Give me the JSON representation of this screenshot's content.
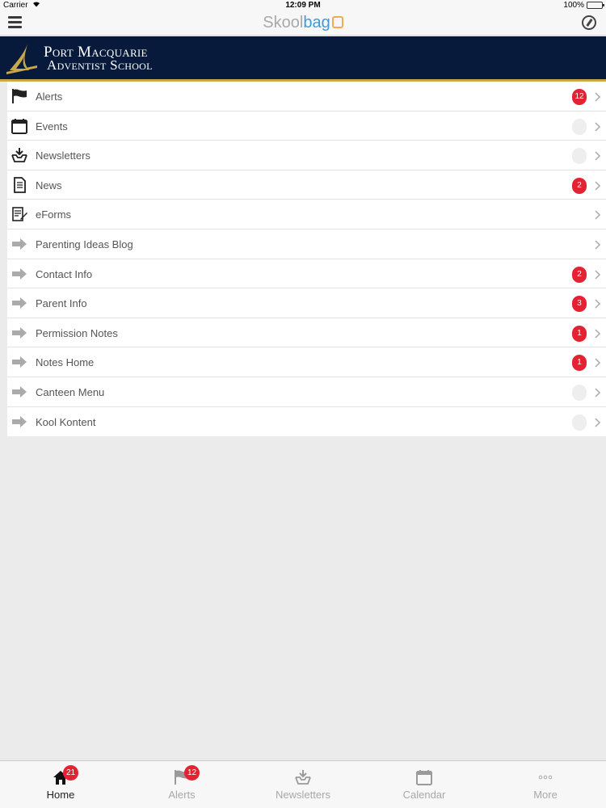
{
  "status_bar": {
    "carrier": "Carrier",
    "time": "12:09 PM",
    "battery": "100%",
    "battery_level": 1.0
  },
  "nav": {
    "brand_part1": "Skool",
    "brand_part2": "bag"
  },
  "banner": {
    "line1": "Port Macquarie",
    "line2": "Adventist School"
  },
  "menu": [
    {
      "label": "Alerts",
      "icon": "flag-icon",
      "badge": "12"
    },
    {
      "label": "Events",
      "icon": "calendar-icon",
      "badge": ""
    },
    {
      "label": "Newsletters",
      "icon": "inbox-download-icon",
      "badge": ""
    },
    {
      "label": "News",
      "icon": "document-icon",
      "badge": "2"
    },
    {
      "label": "eForms",
      "icon": "form-pencil-icon",
      "badge": null
    },
    {
      "label": "Parenting Ideas Blog",
      "icon": "arrow-right-icon",
      "badge": null
    },
    {
      "label": "Contact Info",
      "icon": "arrow-right-icon",
      "badge": "2"
    },
    {
      "label": "Parent Info",
      "icon": "arrow-right-icon",
      "badge": "3"
    },
    {
      "label": "Permission Notes",
      "icon": "arrow-right-icon",
      "badge": "1"
    },
    {
      "label": "Notes Home",
      "icon": "arrow-right-icon",
      "badge": "1"
    },
    {
      "label": "Canteen Menu",
      "icon": "arrow-right-icon",
      "badge": ""
    },
    {
      "label": "Kool Kontent",
      "icon": "arrow-right-icon",
      "badge": ""
    }
  ],
  "tabs": [
    {
      "label": "Home",
      "icon": "home-icon",
      "badge": "21",
      "active": true
    },
    {
      "label": "Alerts",
      "icon": "flag-icon",
      "badge": "12",
      "active": false
    },
    {
      "label": "Newsletters",
      "icon": "inbox-download-icon",
      "badge": null,
      "active": false
    },
    {
      "label": "Calendar",
      "icon": "calendar-icon",
      "badge": null,
      "active": false
    },
    {
      "label": "More",
      "icon": "more-dots-icon",
      "badge": null,
      "active": false
    }
  ],
  "colors": {
    "badge_red": "#e32232",
    "banner_navy": "#071a3b",
    "banner_gold": "#c9a84c",
    "brand_blue": "#3d9bd8",
    "brand_orange": "#f3a94d"
  }
}
